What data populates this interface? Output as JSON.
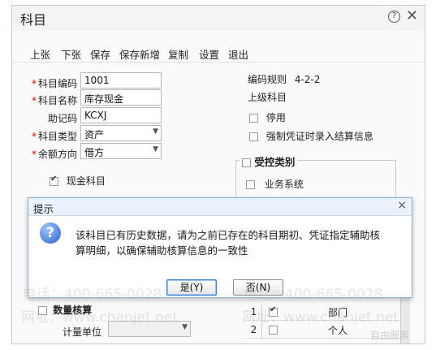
{
  "window": {
    "title": "科目",
    "help_glyph": "?",
    "close_glyph": "✕"
  },
  "toolbar": {
    "items": [
      "上张",
      "下张",
      "保存",
      "保存新增",
      "复制",
      "设置",
      "退出"
    ]
  },
  "form": {
    "code_label": "科目编码",
    "code_value": "1001",
    "name_label": "科目名称",
    "name_value": "库存现金",
    "mnemonic_label": "助记码",
    "mnemonic_value": "KCXJ",
    "type_label": "科目类型",
    "type_value": "资产",
    "balance_label": "余额方向",
    "balance_value": "借方",
    "required_mark": "*",
    "cash_subject_label": "现金科目",
    "qty_accounting_label": "数量核算",
    "unit_label": "计量单位",
    "unit_value": ""
  },
  "right": {
    "code_rule_label": "编码规则",
    "code_rule_value": "4-2-2",
    "parent_label": "上级科目",
    "disabled_label": "停用",
    "force_settle_label": "强制凭证时录入结算信息",
    "controlled_label": "受控类别",
    "business_system_label": "业务系统"
  },
  "aux_grid": {
    "rows": [
      {
        "num": "1",
        "checked": true,
        "name": "部门"
      },
      {
        "num": "2",
        "checked": false,
        "name": "个人"
      }
    ]
  },
  "dialog": {
    "title": "提示",
    "icon": "question-icon",
    "message": "该科目已有历史数据，请为之前已存在的科目期初、凭证指定辅助核算明细，以确保辅助核算信息的一致性",
    "yes_label": "是(Y)",
    "no_label": "否(N)",
    "close_glyph": "×"
  },
  "watermark": {
    "phone": "电话：400-665-0028",
    "site": "网址：www.chanjet.net",
    "corner": "自由服务"
  }
}
